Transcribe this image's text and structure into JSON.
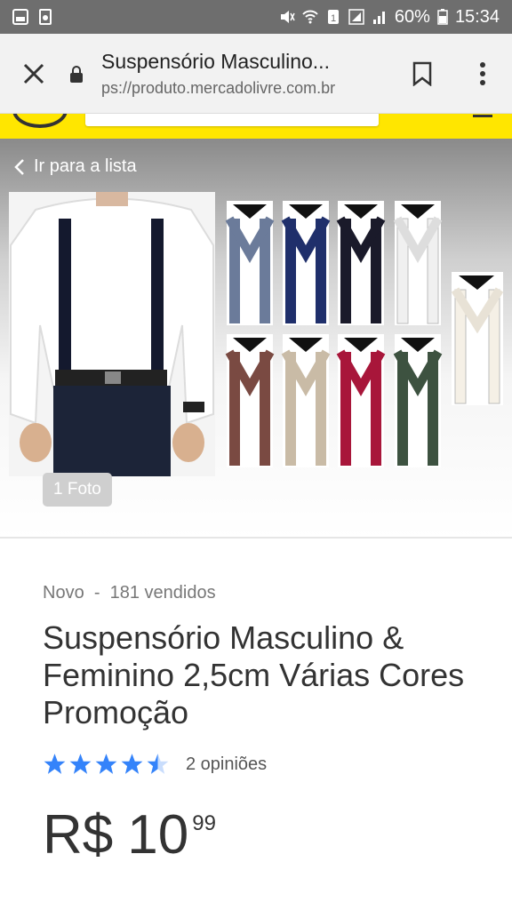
{
  "status_bar": {
    "battery": "60%",
    "time": "15:34"
  },
  "browser": {
    "page_title": "Suspensório Masculino...",
    "url": "ps://produto.mercadolivre.com.br",
    "icons": [
      "close-icon",
      "lock-icon",
      "bookmark-icon",
      "more-vert-icon"
    ]
  },
  "gallery": {
    "back_label": "Ir para a lista",
    "photo_count": "1 Foto"
  },
  "product": {
    "condition": "Novo",
    "separator": "-",
    "sold": "181 vendidos",
    "title": "Suspensório Masculino & Feminino 2,5cm Várias Cores Promoção",
    "rating": 4.5,
    "reviews_label": "2 opiniões",
    "price_currency": "R$",
    "price_integer": "10",
    "price_cents": "99"
  },
  "colors": {
    "status_bar": "#6e6e6e",
    "chrome_bar": "#f2f2f2",
    "brand_yellow": "#ffe600",
    "star_blue": "#3483fa",
    "text": "#333333"
  }
}
